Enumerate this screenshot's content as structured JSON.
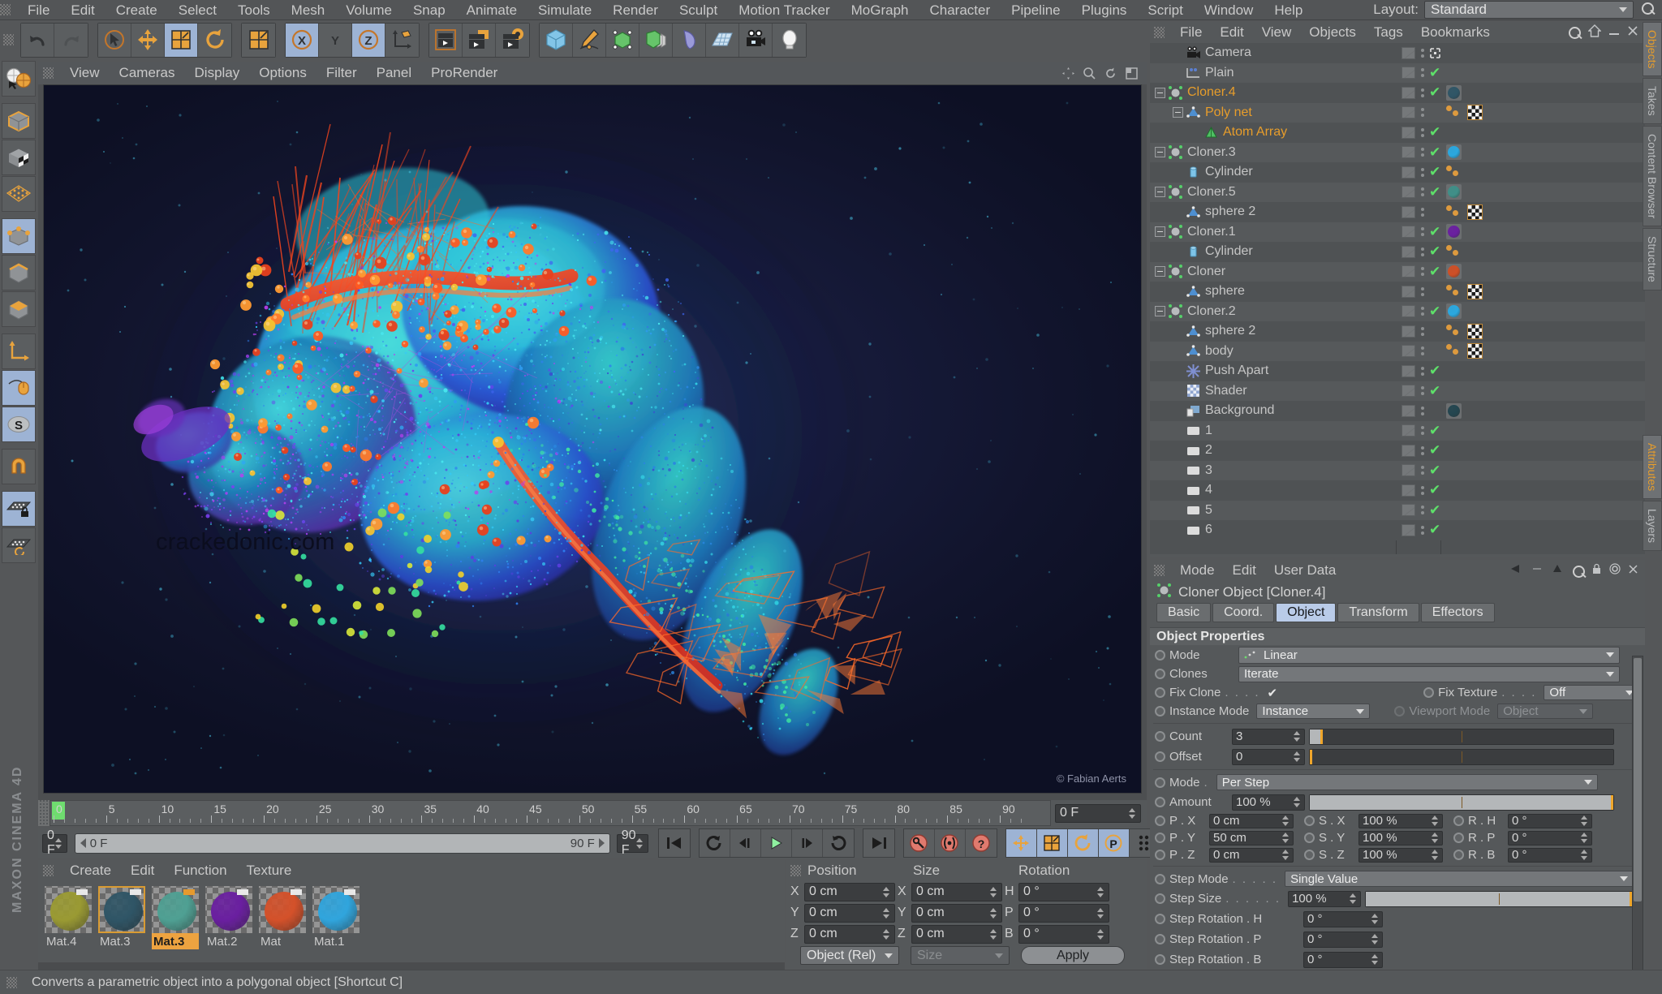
{
  "app": {
    "name": "MAXON CINEMA 4D"
  },
  "top_menu": {
    "items": [
      "File",
      "Edit",
      "Create",
      "Select",
      "Tools",
      "Mesh",
      "Volume",
      "Snap",
      "Animate",
      "Simulate",
      "Render",
      "Sculpt",
      "Motion Tracker",
      "MoGraph",
      "Character",
      "Pipeline",
      "Plugins",
      "Script",
      "Window",
      "Help"
    ],
    "layout_label": "Layout:",
    "layout_value": "Standard",
    "search_icon": "magnifier-icon"
  },
  "toolbar": {
    "groups": [
      {
        "name": "undo-redo",
        "buttons": [
          {
            "icon": "undo-icon",
            "active": false
          },
          {
            "icon": "redo-icon",
            "active": false
          }
        ]
      },
      {
        "name": "transform-tools",
        "buttons": [
          {
            "icon": "select-live-icon",
            "active": false
          },
          {
            "icon": "move-icon",
            "active": false
          },
          {
            "icon": "scale-icon",
            "active": true
          },
          {
            "icon": "rotate-icon",
            "active": false
          }
        ]
      },
      {
        "name": "scale-tool",
        "buttons": [
          {
            "icon": "scale-alt-icon",
            "active": false
          }
        ]
      },
      {
        "name": "axis-locks",
        "buttons": [
          {
            "icon": "axis-x-icon",
            "label": "X",
            "active": true
          },
          {
            "icon": "axis-y-icon",
            "label": "Y",
            "active": false
          },
          {
            "icon": "axis-z-icon",
            "label": "Z",
            "active": true
          },
          {
            "icon": "world-axis-icon",
            "active": false
          }
        ]
      },
      {
        "name": "render-tools",
        "buttons": [
          {
            "icon": "render-view-icon",
            "active": false
          },
          {
            "icon": "render-region-icon",
            "active": false
          },
          {
            "icon": "render-settings-icon",
            "active": false
          }
        ]
      },
      {
        "name": "create-objects",
        "buttons": [
          {
            "icon": "cube-primitive-icon",
            "active": false
          },
          {
            "icon": "spline-pen-icon",
            "active": false
          },
          {
            "icon": "generator-icon",
            "active": false
          },
          {
            "icon": "array-icon",
            "active": false
          },
          {
            "icon": "deformer-icon",
            "active": false
          },
          {
            "icon": "scene-floor-icon",
            "active": false
          },
          {
            "icon": "camera-icon",
            "active": false
          },
          {
            "icon": "light-icon",
            "active": false
          }
        ]
      }
    ]
  },
  "left_toolbar": {
    "buttons": [
      {
        "icon": "live-selection-icon",
        "active": false
      },
      {
        "icon": "model-mode-icon",
        "active": false
      },
      {
        "icon": "texture-mode-icon",
        "active": false
      },
      {
        "icon": "points-mode-icon",
        "active": false
      },
      {
        "icon": "point-mode-icon",
        "active": true
      },
      {
        "icon": "edge-mode-icon",
        "active": false
      },
      {
        "icon": "polygon-mode-icon",
        "active": false
      },
      {
        "icon": "object-axis-icon",
        "active": false
      },
      {
        "icon": "enable-axis-icon",
        "active": true
      },
      {
        "icon": "snap-s-icon",
        "active": true
      },
      {
        "icon": "magnet-icon",
        "active": false
      },
      {
        "icon": "workplane-lock-icon",
        "active": true
      },
      {
        "icon": "workplane-icon",
        "active": false
      }
    ]
  },
  "viewport": {
    "menu": [
      "View",
      "Cameras",
      "Display",
      "Options",
      "Filter",
      "Panel",
      "ProRender"
    ],
    "watermark": "crackedonic.com",
    "credit": "© Fabian Aerts",
    "header_icons": [
      "pan-icon",
      "zoom-icon",
      "rotate-view-icon",
      "maximize-icon"
    ]
  },
  "timeline": {
    "ticks": [
      "0",
      "5",
      "10",
      "15",
      "20",
      "25",
      "30",
      "35",
      "40",
      "45",
      "50",
      "55",
      "60",
      "65",
      "70",
      "75",
      "80",
      "85",
      "90"
    ],
    "current_frame": "0 F",
    "range_start": "0 F",
    "range_end": "90 F",
    "end_field": "90 F",
    "preview_field": "0 F"
  },
  "transport": {
    "buttons": [
      {
        "icon": "go-to-start-icon",
        "active": false
      },
      {
        "icon": "play-backward-loop-icon",
        "active": false
      },
      {
        "icon": "step-back-icon",
        "active": false
      },
      {
        "icon": "play-icon",
        "active": false
      },
      {
        "icon": "step-forward-icon",
        "active": false
      },
      {
        "icon": "loop-icon",
        "active": false
      },
      {
        "icon": "go-to-end-icon",
        "active": false
      },
      {
        "icon": "record-key-icon",
        "active": false
      },
      {
        "icon": "autokey-icon",
        "active": false
      },
      {
        "icon": "keyframe-help-icon",
        "active": false
      },
      {
        "icon": "key-position-icon",
        "active": true
      },
      {
        "icon": "key-scale-icon",
        "active": true
      },
      {
        "icon": "key-rotation-icon",
        "active": true
      },
      {
        "icon": "key-param-icon",
        "active": true
      },
      {
        "icon": "key-pla-icon",
        "active": false
      },
      {
        "icon": "timeline-filmstrip-icon",
        "active": true
      }
    ]
  },
  "material_manager": {
    "menu": [
      "Create",
      "Edit",
      "Function",
      "Texture"
    ],
    "materials": [
      {
        "name": "Mat.4",
        "color": "#9a9a33",
        "selected": false,
        "active_label": false,
        "tag": "white"
      },
      {
        "name": "Mat.3",
        "color": "#2f5566",
        "selected": true,
        "active_label": false,
        "tag": "white"
      },
      {
        "name": "Mat.3",
        "color": "#4fa093",
        "selected": false,
        "active_label": true,
        "tag": "orange"
      },
      {
        "name": "Mat.2",
        "color": "#6a1fa0",
        "selected": false,
        "active_label": false,
        "tag": "white"
      },
      {
        "name": "Mat",
        "color": "#d4512a",
        "selected": false,
        "active_label": false,
        "tag": "white"
      },
      {
        "name": "Mat.1",
        "color": "#30a5dd",
        "selected": false,
        "active_label": false,
        "tag": "white"
      }
    ]
  },
  "coordinates": {
    "headers": [
      "Position",
      "Size",
      "Rotation"
    ],
    "rows": [
      {
        "pos_axis": "X",
        "pos": "0 cm",
        "size_axis": "X",
        "size": "0 cm",
        "rot_axis": "H",
        "rot": "0 °"
      },
      {
        "pos_axis": "Y",
        "pos": "0 cm",
        "size_axis": "Y",
        "size": "0 cm",
        "rot_axis": "P",
        "rot": "0 °"
      },
      {
        "pos_axis": "Z",
        "pos": "0 cm",
        "size_axis": "Z",
        "size": "0 cm",
        "rot_axis": "B",
        "rot": "0 °"
      }
    ],
    "mode": "Object (Rel)",
    "size_mode": "Size",
    "apply": "Apply"
  },
  "object_manager": {
    "menu": [
      "File",
      "Edit",
      "View",
      "Objects",
      "Tags",
      "Bookmarks"
    ],
    "items": [
      {
        "name": "Camera",
        "indent": 1,
        "icon": "camera-object-icon",
        "selected": false,
        "expander": false,
        "visdots": true,
        "check": false,
        "move": true,
        "tags": []
      },
      {
        "name": "Plain",
        "indent": 1,
        "icon": "plain-effector-icon",
        "selected": false,
        "expander": false,
        "visdots": true,
        "check": true,
        "move": false,
        "tags": []
      },
      {
        "name": "Cloner.4",
        "indent": 0,
        "icon": "cloner-icon",
        "selected": true,
        "expander": true,
        "visdots": true,
        "check": true,
        "move": false,
        "tags": [
          {
            "type": "material",
            "color": "#2f5566"
          }
        ]
      },
      {
        "name": "Poly net",
        "indent": 1,
        "icon": "polygon-object-icon",
        "selected": true,
        "expander": true,
        "visdots": true,
        "check": false,
        "move": false,
        "tags": [
          {
            "type": "dots"
          },
          {
            "type": "checker"
          }
        ]
      },
      {
        "name": "Atom Array",
        "indent": 2,
        "icon": "atom-array-icon",
        "selected": true,
        "expander": false,
        "visdots": true,
        "check": true,
        "move": false,
        "tags": []
      },
      {
        "name": "Cloner.3",
        "indent": 0,
        "icon": "cloner-icon",
        "selected": false,
        "expander": true,
        "visdots": true,
        "check": true,
        "move": false,
        "tags": [
          {
            "type": "material",
            "color": "#2aa8e0"
          }
        ]
      },
      {
        "name": "Cylinder",
        "indent": 1,
        "icon": "cylinder-icon",
        "selected": false,
        "expander": false,
        "visdots": true,
        "check": true,
        "move": false,
        "tags": [
          {
            "type": "dots"
          }
        ]
      },
      {
        "name": "Cloner.5",
        "indent": 0,
        "icon": "cloner-icon",
        "selected": false,
        "expander": true,
        "visdots": true,
        "check": true,
        "move": false,
        "tags": [
          {
            "type": "material",
            "color": "#3f8f88"
          }
        ]
      },
      {
        "name": "sphere 2",
        "indent": 1,
        "icon": "polygon-object-icon",
        "selected": false,
        "expander": false,
        "visdots": true,
        "check": false,
        "move": false,
        "tags": [
          {
            "type": "dots"
          },
          {
            "type": "checker"
          }
        ]
      },
      {
        "name": "Cloner.1",
        "indent": 0,
        "icon": "cloner-icon",
        "selected": false,
        "expander": true,
        "visdots": true,
        "check": true,
        "move": false,
        "tags": [
          {
            "type": "material",
            "color": "#6a1fa0"
          }
        ]
      },
      {
        "name": "Cylinder",
        "indent": 1,
        "icon": "cylinder-icon",
        "selected": false,
        "expander": false,
        "visdots": true,
        "check": true,
        "move": false,
        "tags": [
          {
            "type": "dots"
          }
        ]
      },
      {
        "name": "Cloner",
        "indent": 0,
        "icon": "cloner-icon",
        "selected": false,
        "expander": true,
        "visdots": true,
        "check": true,
        "move": false,
        "tags": [
          {
            "type": "material",
            "color": "#cf4f26"
          }
        ]
      },
      {
        "name": "sphere",
        "indent": 1,
        "icon": "polygon-object-icon",
        "selected": false,
        "expander": false,
        "visdots": true,
        "check": false,
        "move": false,
        "tags": [
          {
            "type": "dots"
          },
          {
            "type": "checker"
          }
        ]
      },
      {
        "name": "Cloner.2",
        "indent": 0,
        "icon": "cloner-icon",
        "selected": false,
        "expander": true,
        "visdots": true,
        "check": true,
        "move": false,
        "tags": [
          {
            "type": "material",
            "color": "#2aa8e0"
          }
        ]
      },
      {
        "name": "sphere 2",
        "indent": 1,
        "icon": "polygon-object-icon",
        "selected": false,
        "expander": false,
        "visdots": true,
        "check": false,
        "move": false,
        "tags": [
          {
            "type": "dots"
          },
          {
            "type": "checker"
          }
        ]
      },
      {
        "name": "body",
        "indent": 1,
        "icon": "polygon-object-icon",
        "selected": false,
        "expander": false,
        "visdots": true,
        "check": false,
        "move": false,
        "tags": [
          {
            "type": "dots"
          },
          {
            "type": "checker"
          }
        ]
      },
      {
        "name": "Push Apart",
        "indent": 1,
        "icon": "push-apart-icon",
        "selected": false,
        "expander": false,
        "visdots": true,
        "check": true,
        "move": false,
        "tags": []
      },
      {
        "name": "Shader",
        "indent": 1,
        "icon": "shader-effector-icon",
        "selected": false,
        "expander": false,
        "visdots": true,
        "check": true,
        "move": false,
        "tags": []
      },
      {
        "name": "Background",
        "indent": 1,
        "icon": "background-icon",
        "selected": false,
        "expander": false,
        "visdots": true,
        "check": false,
        "move": false,
        "tags": [
          {
            "type": "material",
            "color": "#23454f"
          }
        ]
      },
      {
        "name": "1",
        "indent": 1,
        "icon": "layer-icon",
        "selected": false,
        "expander": false,
        "visdots": true,
        "check": true,
        "move": false,
        "tags": []
      },
      {
        "name": "2",
        "indent": 1,
        "icon": "layer-icon",
        "selected": false,
        "expander": false,
        "visdots": true,
        "check": true,
        "move": false,
        "tags": []
      },
      {
        "name": "3",
        "indent": 1,
        "icon": "layer-icon",
        "selected": false,
        "expander": false,
        "visdots": true,
        "check": true,
        "move": false,
        "tags": []
      },
      {
        "name": "4",
        "indent": 1,
        "icon": "layer-icon",
        "selected": false,
        "expander": false,
        "visdots": true,
        "check": true,
        "move": false,
        "tags": []
      },
      {
        "name": "5",
        "indent": 1,
        "icon": "layer-icon",
        "selected": false,
        "expander": false,
        "visdots": true,
        "check": true,
        "move": false,
        "tags": []
      },
      {
        "name": "6",
        "indent": 1,
        "icon": "layer-icon",
        "selected": false,
        "expander": false,
        "visdots": true,
        "check": true,
        "move": false,
        "tags": []
      }
    ]
  },
  "attribute_manager": {
    "menu": [
      "Mode",
      "Edit",
      "User Data"
    ],
    "object_title": "Cloner Object [Cloner.4]",
    "object_icon": "cloner-icon",
    "tabs": [
      {
        "label": "Basic",
        "active": false
      },
      {
        "label": "Coord.",
        "active": false
      },
      {
        "label": "Object",
        "active": true
      },
      {
        "label": "Transform",
        "active": false
      },
      {
        "label": "Effectors",
        "active": false
      }
    ],
    "section_title": "Object Properties",
    "fields": {
      "mode_label": "Mode",
      "mode_value": "Linear",
      "clones_label": "Clones",
      "clones_value": "Iterate",
      "fix_clone_label": "Fix Clone",
      "fix_clone_dots": ". . . .",
      "fix_clone_checked": true,
      "fix_texture_label": "Fix Texture",
      "fix_texture_dots": ". . . .",
      "fix_texture_value": "Off",
      "instance_mode_label": "Instance Mode",
      "instance_mode_value": "Instance",
      "viewport_mode_label": "Viewport Mode",
      "viewport_mode_value": "Object",
      "count_label": "Count",
      "count_value": "3",
      "offset_label": "Offset",
      "offset_value": "0",
      "step_mode_label": "Mode",
      "step_mode_dot": ".",
      "step_mode_value": "Per Step",
      "amount_label": "Amount",
      "amount_value": "100 %",
      "transform_rows": [
        {
          "p_label": "P . X",
          "p_value": "0 cm",
          "s_label": "S . X",
          "s_value": "100 %",
          "r_label": "R . H",
          "r_value": "0 °"
        },
        {
          "p_label": "P . Y",
          "p_value": "50 cm",
          "s_label": "S . Y",
          "s_value": "100 %",
          "r_label": "R . P",
          "r_value": "0 °"
        },
        {
          "p_label": "P . Z",
          "p_value": "0 cm",
          "s_label": "S . Z",
          "s_value": "100 %",
          "r_label": "R . B",
          "r_value": "0 °"
        }
      ],
      "step_mode2_label": "Step Mode",
      "step_mode2_dots": ". . . . .",
      "step_mode2_value": "Single Value",
      "step_size_label": "Step Size",
      "step_size_dots": ". . . . . .",
      "step_size_value": "100 %",
      "step_rot_h_label": "Step Rotation . H",
      "step_rot_h_value": "0 °",
      "step_rot_p_label": "Step Rotation . P",
      "step_rot_p_value": "0 °",
      "step_rot_b_label": "Step Rotation . B",
      "step_rot_b_value": "0 °"
    }
  },
  "right_tabs": {
    "upper": [
      {
        "label": "Objects",
        "active": true
      },
      {
        "label": "Takes",
        "active": false
      },
      {
        "label": "Content Browser",
        "active": false
      },
      {
        "label": "Structure",
        "active": false
      }
    ],
    "lower": [
      {
        "label": "Attributes",
        "active": true
      },
      {
        "label": "Layers",
        "active": false
      }
    ]
  },
  "status_bar": {
    "text": "Converts a parametric object into a polygonal object [Shortcut C]"
  },
  "colors": {
    "accent_orange": "#e79d2b",
    "panel_bg": "#55585a",
    "field_bg": "#3b3d3f",
    "active_blue": "#9db3d4",
    "check_green": "#5ee06a"
  }
}
